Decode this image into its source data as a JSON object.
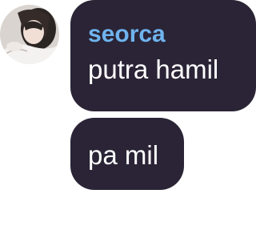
{
  "chat": {
    "messages": [
      {
        "username": "seorca",
        "text": "putra hamil"
      },
      {
        "text": "pa mil"
      }
    ]
  },
  "colors": {
    "bubble": "#2a2436",
    "username": "#6fb4ee",
    "text": "#ffffff"
  },
  "avatar": {
    "icon": "user-avatar-photo"
  }
}
